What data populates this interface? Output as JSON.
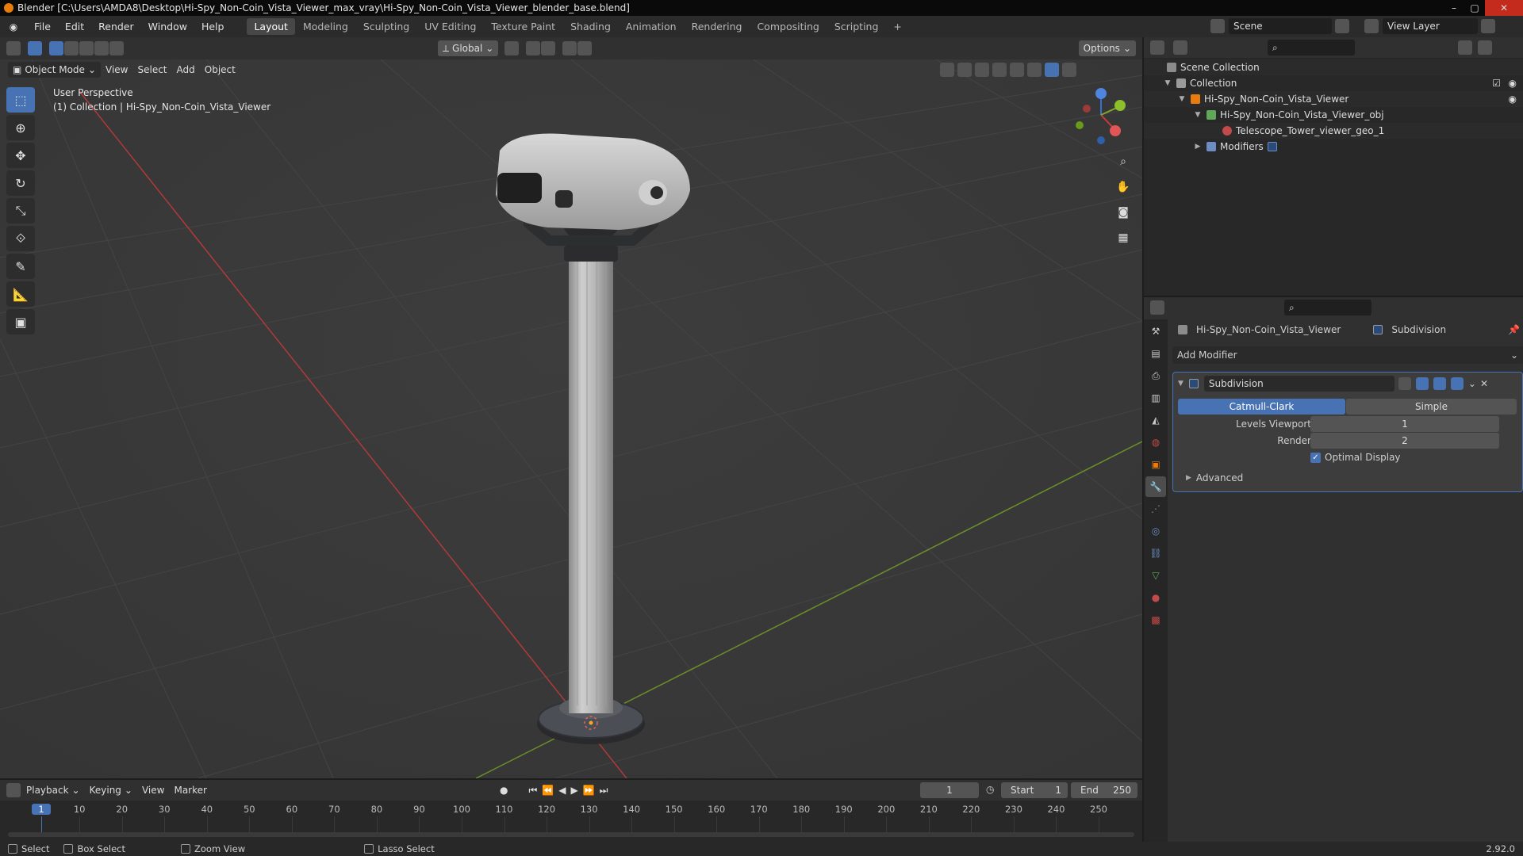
{
  "window": {
    "title": "Blender [C:\\Users\\AMDA8\\Desktop\\Hi-Spy_Non-Coin_Vista_Viewer_max_vray\\Hi-Spy_Non-Coin_Vista_Viewer_blender_base.blend]"
  },
  "menu": {
    "file": "File",
    "edit": "Edit",
    "render": "Render",
    "window": "Window",
    "help": "Help"
  },
  "workspaces": [
    "Layout",
    "Modeling",
    "Sculpting",
    "UV Editing",
    "Texture Paint",
    "Shading",
    "Animation",
    "Rendering",
    "Compositing",
    "Scripting"
  ],
  "scene": {
    "name": "Scene",
    "view_layer": "View Layer"
  },
  "viewport": {
    "transform_orientation": "Global",
    "options_label": "Options",
    "mode": "Object Mode",
    "menu_view": "View",
    "menu_select": "Select",
    "menu_add": "Add",
    "menu_object": "Object",
    "overlay_line1": "User Perspective",
    "overlay_line2": "(1) Collection | Hi-Spy_Non-Coin_Vista_Viewer"
  },
  "outliner": {
    "scene_collection": "Scene Collection",
    "collection": "Collection",
    "object": "Hi-Spy_Non-Coin_Vista_Viewer",
    "mesh": "Hi-Spy_Non-Coin_Vista_Viewer_obj",
    "material": "Telescope_Tower_viewer_geo_1",
    "modifiers": "Modifiers"
  },
  "properties": {
    "object_name": "Hi-Spy_Non-Coin_Vista_Viewer",
    "modifier_breadcrumb": "Subdivision",
    "add_modifier": "Add Modifier",
    "modifier_name": "Subdivision",
    "method_a": "Catmull-Clark",
    "method_b": "Simple",
    "levels_viewport_label": "Levels Viewport",
    "levels_viewport_value": "1",
    "render_label": "Render",
    "render_value": "2",
    "optimal_display": "Optimal Display",
    "advanced": "Advanced"
  },
  "timeline": {
    "playback": "Playback",
    "keying": "Keying",
    "view": "View",
    "marker": "Marker",
    "current_frame": "1",
    "start_label": "Start",
    "start": "1",
    "end_label": "End",
    "end": "250",
    "ticks": [
      "1",
      "10",
      "20",
      "30",
      "40",
      "50",
      "60",
      "70",
      "80",
      "90",
      "100",
      "110",
      "120",
      "130",
      "140",
      "150",
      "160",
      "170",
      "180",
      "190",
      "200",
      "210",
      "220",
      "230",
      "240",
      "250"
    ]
  },
  "statusbar": {
    "select": "Select",
    "box_select": "Box Select",
    "zoom_view": "Zoom View",
    "lasso_select": "Lasso Select",
    "version": "2.92.0"
  },
  "colors": {
    "accent": "#4772b3",
    "x_axis": "#c63c3c",
    "y_axis": "#7fa82a",
    "orange": "#e87d0d"
  }
}
